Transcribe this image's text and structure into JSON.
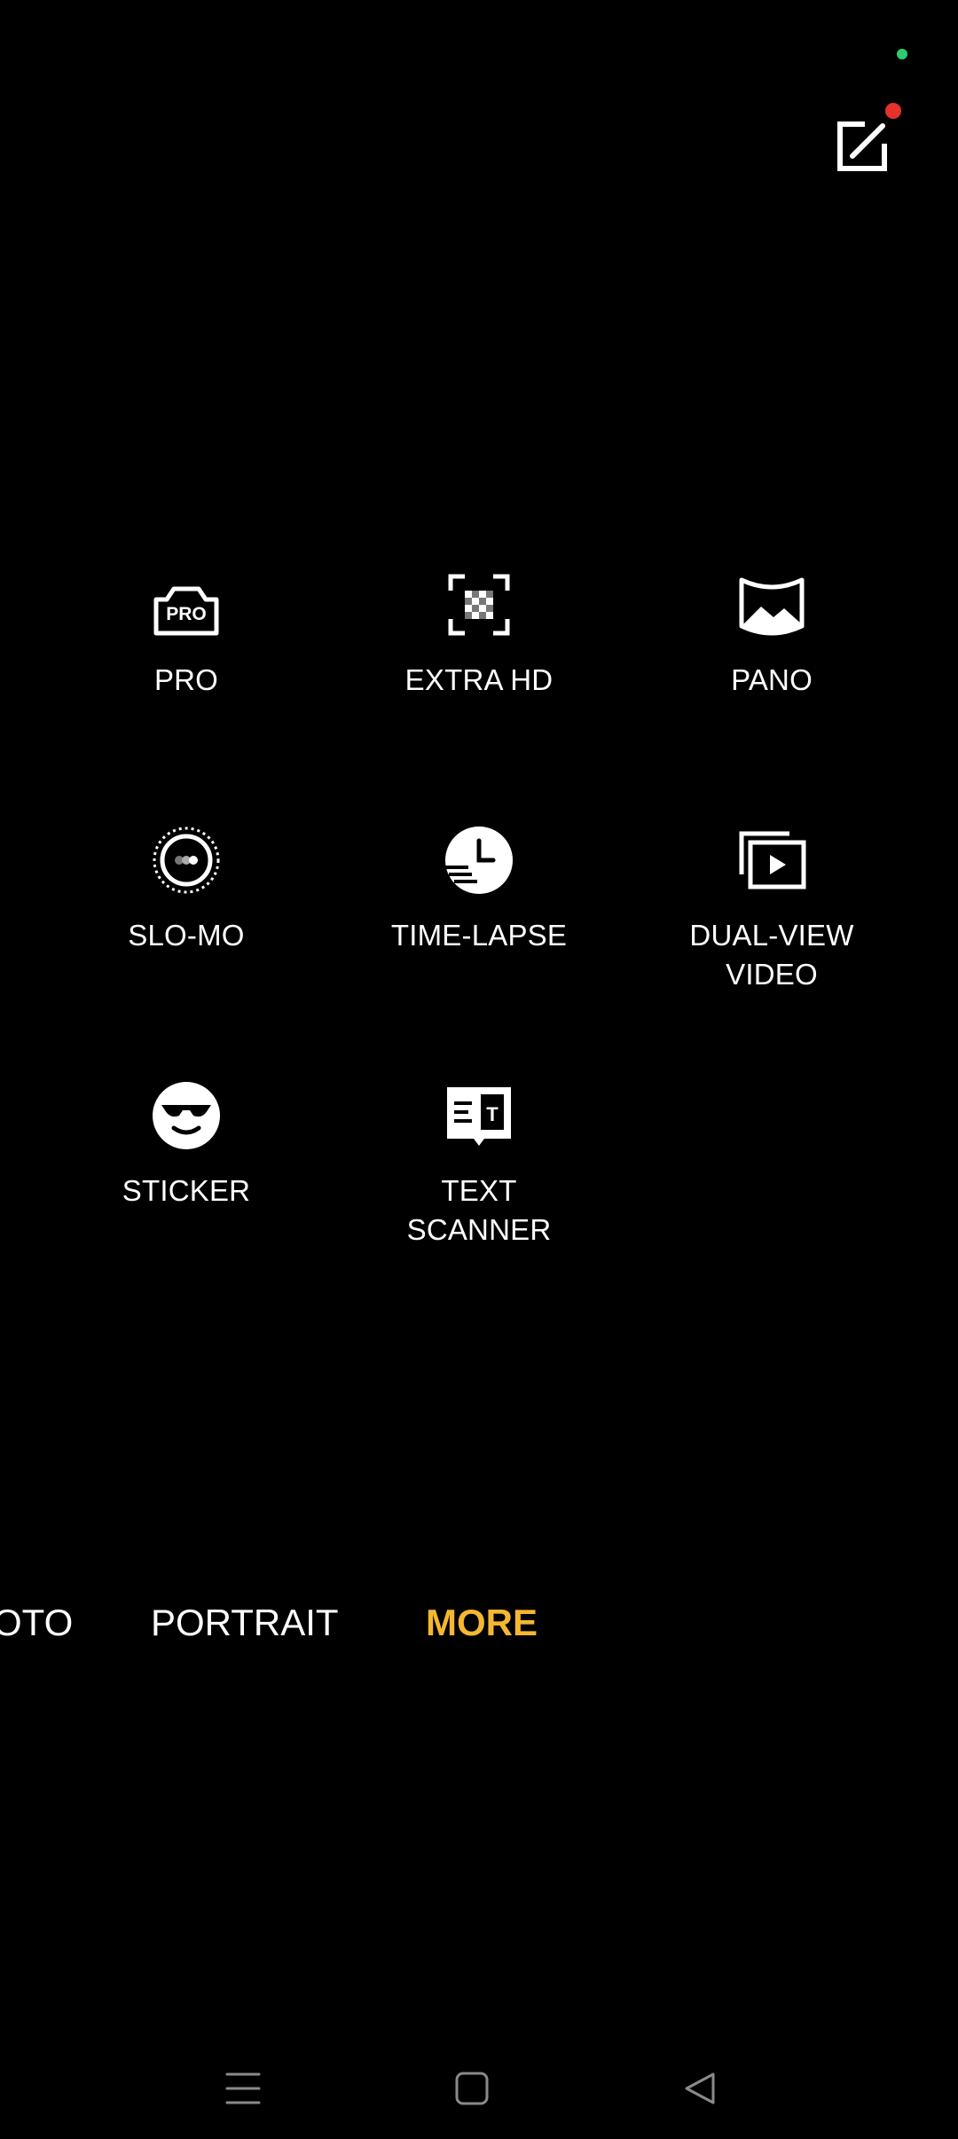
{
  "colors": {
    "background": "#000000",
    "foreground": "#ffffff",
    "accent": "#f5b731",
    "status_dot": "#2ecc71",
    "badge": "#e5322d",
    "nav_icon": "#8a8a8a"
  },
  "top_bar": {
    "edit_icon": "edit-icon"
  },
  "modes": [
    {
      "label": "PRO",
      "icon": "pro-camera-icon"
    },
    {
      "label": "EXTRA HD",
      "icon": "extra-hd-icon"
    },
    {
      "label": "PANO",
      "icon": "pano-icon"
    },
    {
      "label": "SLO-MO",
      "icon": "slow-motion-icon"
    },
    {
      "label": "TIME-LAPSE",
      "icon": "time-lapse-icon"
    },
    {
      "label": "DUAL-VIEW\nVIDEO",
      "icon": "dual-view-video-icon"
    },
    {
      "label": "STICKER",
      "icon": "sticker-icon"
    },
    {
      "label": "TEXT\nSCANNER",
      "icon": "text-scanner-icon"
    }
  ],
  "mode_strip": {
    "tabs": [
      "OTO",
      "PORTRAIT",
      "MORE"
    ],
    "active": "MORE"
  },
  "nav_bar": {
    "icons": [
      "menu-icon",
      "home-icon",
      "back-icon"
    ]
  }
}
